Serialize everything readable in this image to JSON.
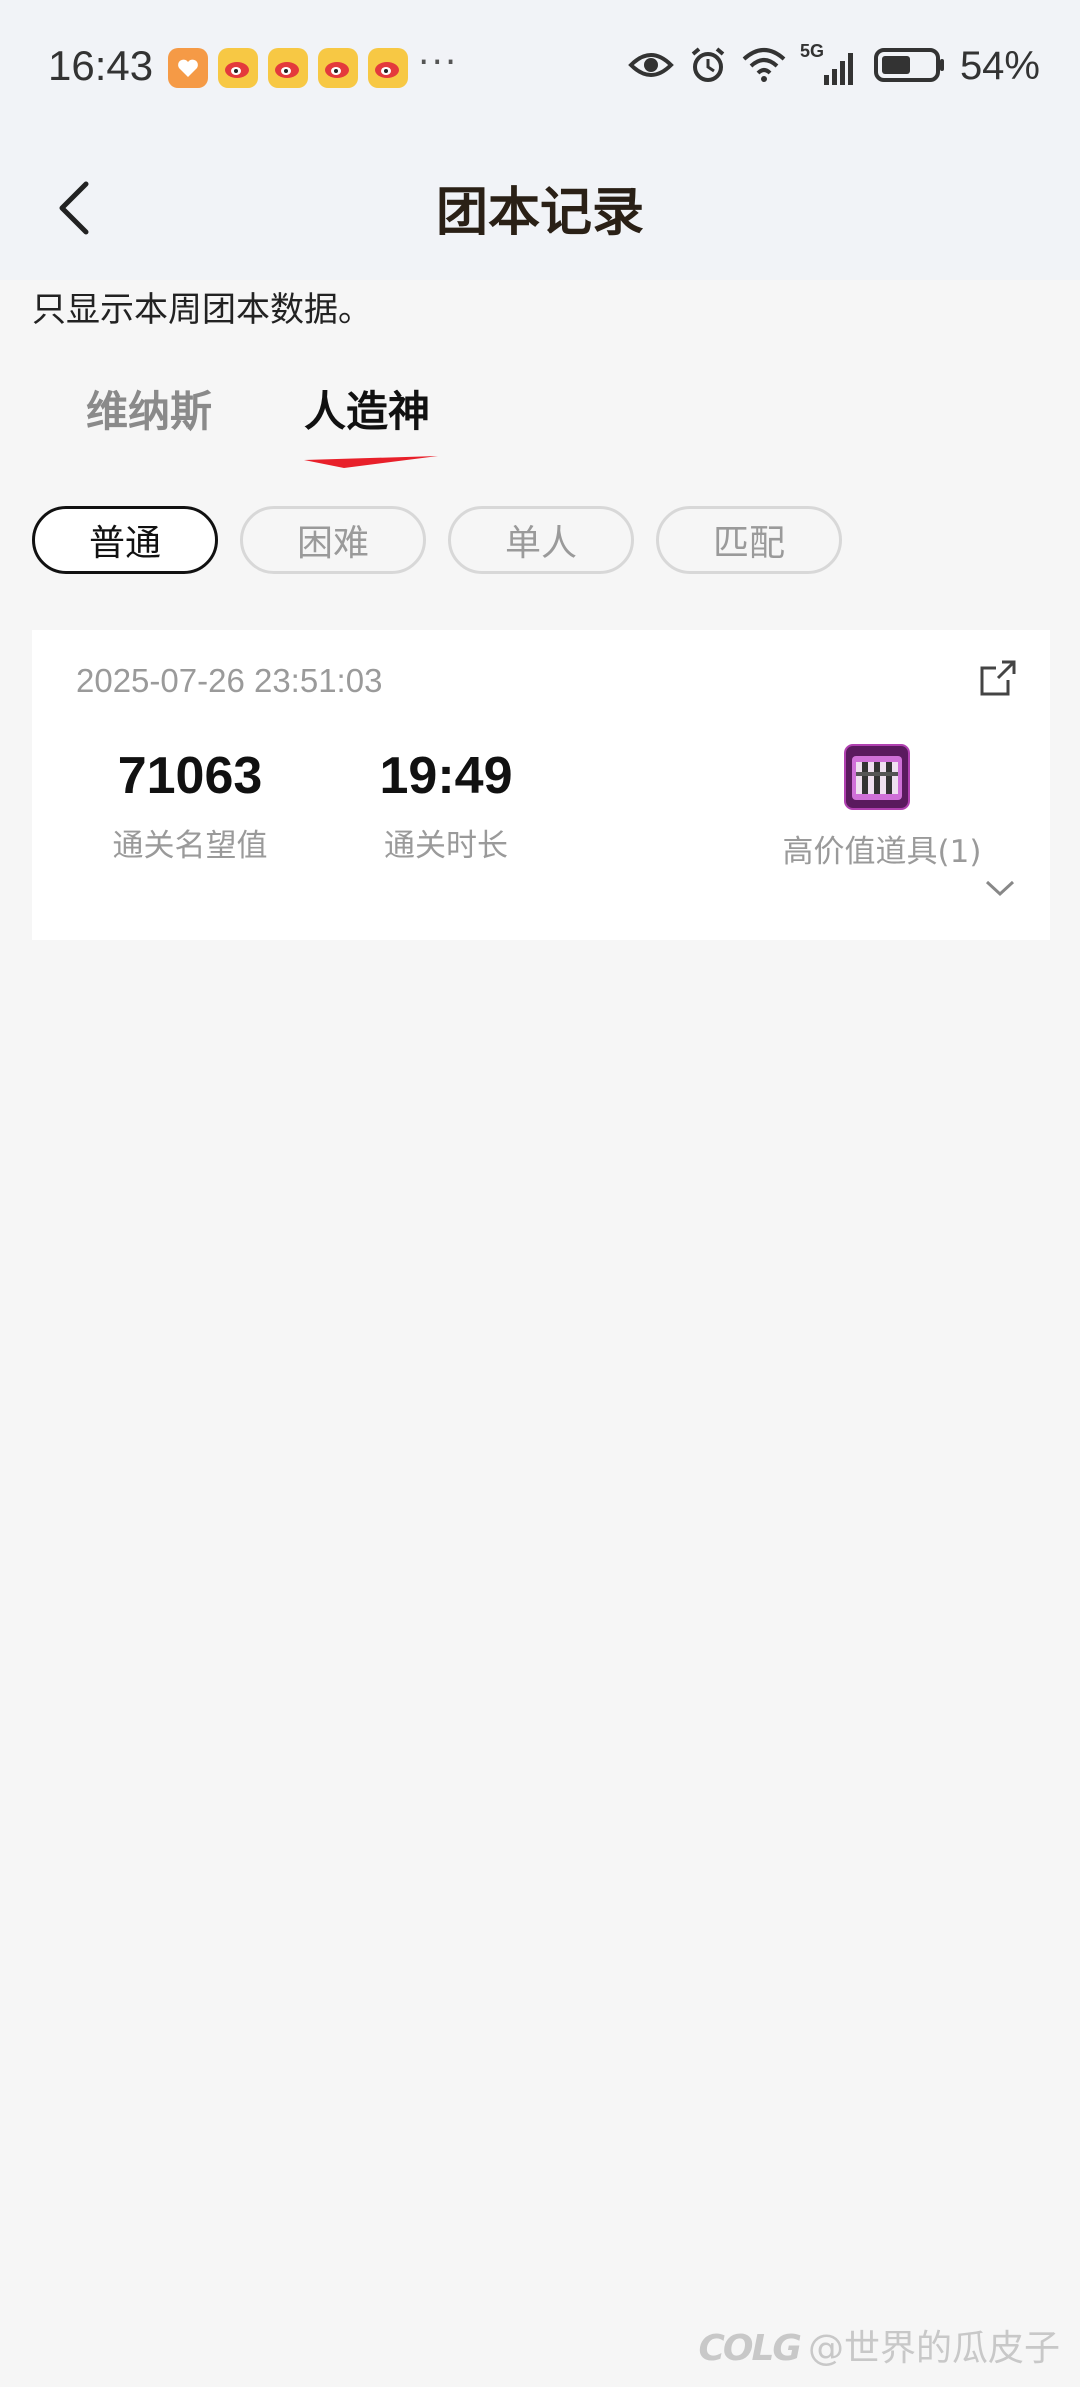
{
  "status_bar": {
    "time": "16:43",
    "more": "···",
    "network": "5G",
    "battery": "54%"
  },
  "header": {
    "title": "团本记录"
  },
  "notice": "只显示本周团本数据。",
  "tabs": [
    {
      "label": "维纳斯",
      "active": false
    },
    {
      "label": "人造神",
      "active": true
    }
  ],
  "filters": [
    {
      "label": "普通",
      "active": true
    },
    {
      "label": "困难",
      "active": false
    },
    {
      "label": "单人",
      "active": false
    },
    {
      "label": "匹配",
      "active": false
    }
  ],
  "record": {
    "date": "2025-07-26 23:51:03",
    "reputation_value": "71063",
    "reputation_label": "通关名望值",
    "duration_value": "19:49",
    "duration_label": "通关时长",
    "items_label": "高价值道具(1)"
  },
  "watermark": {
    "logo": "COLG",
    "text": "@世界的瓜皮子"
  },
  "colors": {
    "accent": "#e8202a",
    "text_primary": "#111111",
    "text_secondary": "#9a9a9a"
  }
}
